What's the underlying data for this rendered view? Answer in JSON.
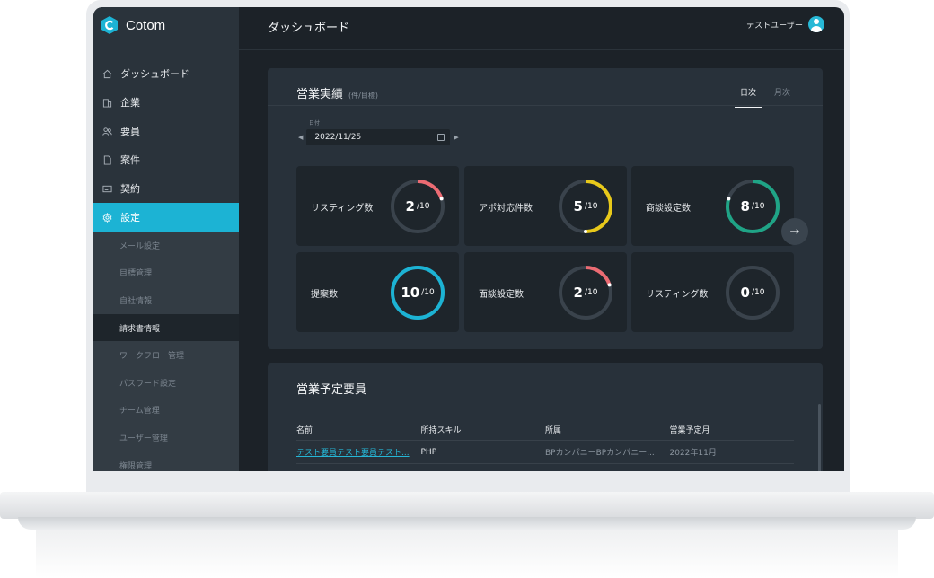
{
  "app": {
    "name": "Cotom"
  },
  "header": {
    "title": "ダッシュボード",
    "user_name": "テストユーザー"
  },
  "sidebar": {
    "items": [
      {
        "label": "ダッシュボード",
        "icon": "home-icon"
      },
      {
        "label": "企業",
        "icon": "building-icon"
      },
      {
        "label": "要員",
        "icon": "users-icon"
      },
      {
        "label": "案件",
        "icon": "document-icon"
      },
      {
        "label": "契約",
        "icon": "contract-icon"
      },
      {
        "label": "設定",
        "icon": "gear-icon",
        "active": true
      }
    ],
    "sub_items": [
      {
        "label": "メール設定"
      },
      {
        "label": "目標管理"
      },
      {
        "label": "自社情報"
      },
      {
        "label": "請求書情報",
        "current": true
      },
      {
        "label": "ワークフロー管理"
      },
      {
        "label": "パスワード設定"
      },
      {
        "label": "チーム管理"
      },
      {
        "label": "ユーザー管理"
      },
      {
        "label": "権限管理"
      }
    ]
  },
  "sales": {
    "title": "営業実績",
    "subtitle": "(件/目標)",
    "tabs": [
      {
        "label": "日次",
        "active": true
      },
      {
        "label": "月次"
      }
    ],
    "date_label": "日付",
    "date_value": "2022/11/25",
    "stats": [
      {
        "label": "リスティング数",
        "value": "2",
        "target": "/10",
        "progress": 0.2,
        "color": "#ec6b73"
      },
      {
        "label": "アポ対応件数",
        "value": "5",
        "target": "/10",
        "progress": 0.5,
        "color": "#e8c91a"
      },
      {
        "label": "商談設定数",
        "value": "8",
        "target": "/10",
        "progress": 0.8,
        "color": "#1fa486"
      },
      {
        "label": "提案数",
        "value": "10",
        "target": "/10",
        "progress": 1.0,
        "color": "#1cb3d4"
      },
      {
        "label": "面談設定数",
        "value": "2",
        "target": "/10",
        "progress": 0.2,
        "color": "#ec6b73"
      },
      {
        "label": "リスティング数",
        "value": "0",
        "target": "/10",
        "progress": 0.0,
        "color": "#ec6b73"
      }
    ],
    "ring_track_color": "#3a434c"
  },
  "schedule": {
    "title": "営業予定要員",
    "columns": [
      "名前",
      "所持スキル",
      "所属",
      "営業予定月"
    ],
    "rows": [
      {
        "name": "テスト要員テスト要員テスト...",
        "skill": "PHP",
        "affiliation": "BPカンパニーBPカンパニー...",
        "month": "2022年11月"
      }
    ]
  },
  "colors": {
    "accent": "#1cb3d4",
    "sidebar_bg": "#2a333b",
    "main_bg": "#1c2228",
    "card_bg": "#28313a"
  }
}
